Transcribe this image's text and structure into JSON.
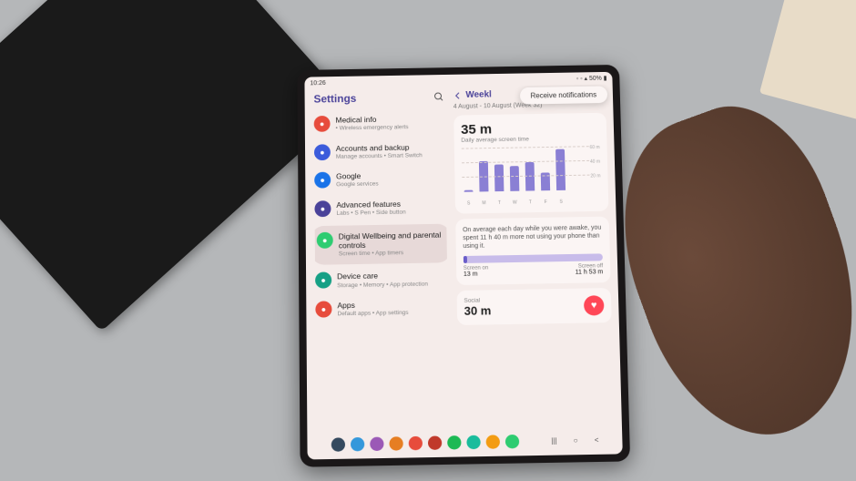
{
  "statusbar": {
    "time": "10:26",
    "battery": "50%"
  },
  "left": {
    "title": "Settings",
    "items": [
      {
        "icon_bg": "#e74c3c",
        "title": "Medical info",
        "sub": "• Wireless emergency alerts",
        "partial": true
      },
      {
        "icon_bg": "#3b5bdb",
        "title": "Accounts and backup",
        "sub": "Manage accounts • Smart Switch"
      },
      {
        "icon_bg": "#1a73e8",
        "title": "Google",
        "sub": "Google services"
      },
      {
        "icon_bg": "#4a4299",
        "title": "Advanced features",
        "sub": "Labs • S Pen • Side button"
      },
      {
        "icon_bg": "#2ecc71",
        "title": "Digital Wellbeing and parental controls",
        "sub": "Screen time • App timers",
        "active": true
      },
      {
        "icon_bg": "#16a085",
        "title": "Device care",
        "sub": "Storage • Memory • App protection"
      },
      {
        "icon_bg": "#e74c3c",
        "title": "Apps",
        "sub": "Default apps • App settings"
      }
    ]
  },
  "right": {
    "title": "Weekl",
    "popup": "Receive notifications",
    "date_range": "4 August - 10 August (Week 32)",
    "screen_time": {
      "value": "35 m",
      "label": "Daily average screen time"
    },
    "avg_text": "On average each day while you were awake, you spent 11 h 40 m more not using your phone than using it.",
    "on_label": "Screen on",
    "on_value": "13 m",
    "off_label": "Screen off",
    "off_value": "11 h 53 m",
    "category": {
      "name": "Social",
      "value": "30 m"
    }
  },
  "chart_data": {
    "type": "bar",
    "title": "Daily average screen time",
    "categories": [
      "S",
      "M",
      "T",
      "W",
      "T",
      "F",
      "S"
    ],
    "values": [
      2,
      42,
      38,
      35,
      40,
      25,
      58
    ],
    "ylim": [
      0,
      60
    ],
    "yticks": [
      20,
      40,
      60
    ],
    "yticklabels": [
      "20 m",
      "40 m",
      "60 m"
    ],
    "ylabel": "minutes"
  },
  "dock_colors": [
    "#34495e",
    "#3498db",
    "#9b59b6",
    "#e67e22",
    "#e74c3c",
    "#c0392b",
    "#1db954",
    "#1abc9c",
    "#f39c12",
    "#2ecc71"
  ]
}
